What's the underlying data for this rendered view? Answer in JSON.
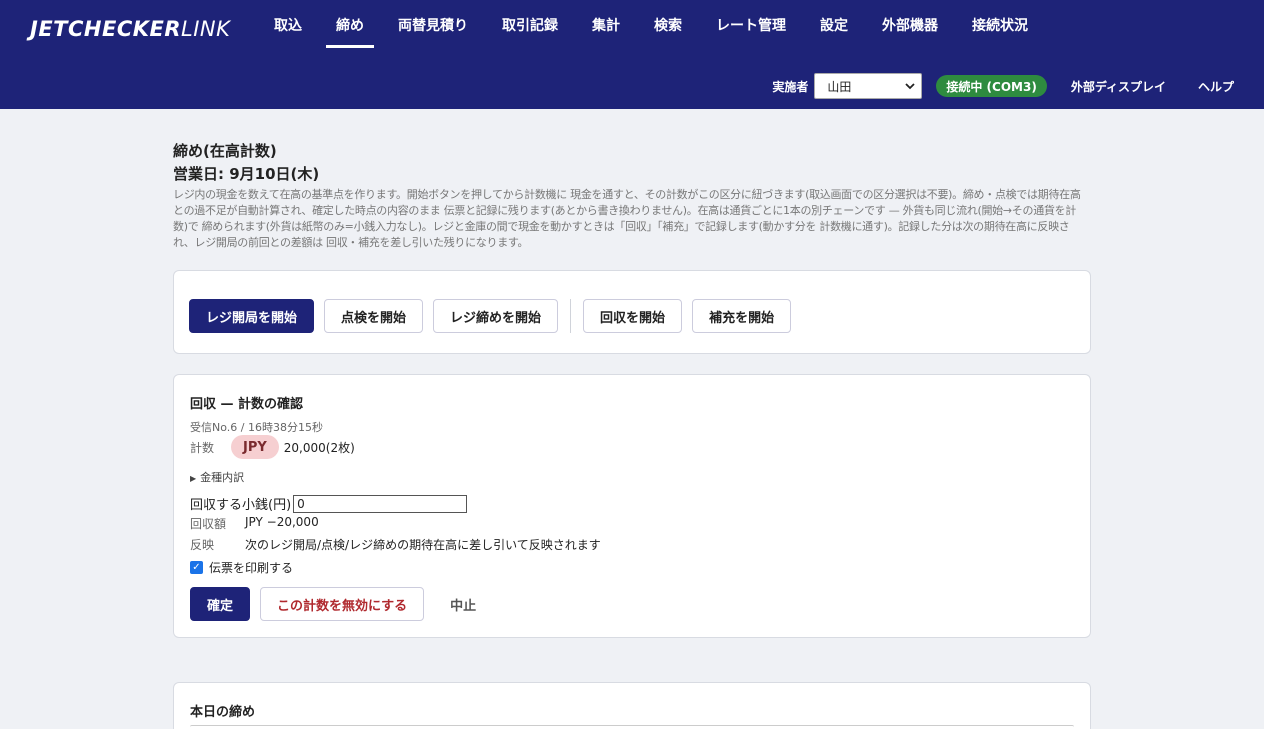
{
  "header": {
    "logo_bold": "JETCHECKER",
    "logo_light": "LINK",
    "nav": [
      "取込",
      "締め",
      "両替見積り",
      "取引記録",
      "集計",
      "検索",
      "レート管理",
      "設定",
      "外部機器",
      "接続状況"
    ],
    "active_nav": "締め",
    "operator_label": "実施者",
    "operator_value": "山田",
    "connection_status": "接続中 (COM3)",
    "external_display": "外部ディスプレイ",
    "help": "ヘルプ"
  },
  "page": {
    "title": "締め(在高計数)",
    "business_day": "営業日: 9月10日(木)",
    "description": "レジ内の現金を数えて在高の基準点を作ります。開始ボタンを押してから計数機に 現金を通すと、その計数がこの区分に紐づきます(取込画面での区分選択は不要)。締め・点検では期待在高との過不足が自動計算され、確定した時点の内容のまま 伝票と記録に残ります(あとから書き換わりません)。在高は通貨ごとに1本の別チェーンです — 外貨も同じ流れ(開始→その通貨を計数)で 締められます(外貨は紙幣のみ=小銭入力なし)。レジと金庫の間で現金を動かすときは「回収」「補充」で記録します(動かす分を 計数機に通す)。記録した分は次の期待在高に反映され、レジ開局の前回との差額は 回収・補充を差し引いた残りになります。"
  },
  "actions": {
    "open": "レジ開局を開始",
    "inspect": "点検を開始",
    "close": "レジ締めを開始",
    "collect": "回収を開始",
    "replenish": "補充を開始"
  },
  "confirm_panel": {
    "title": "回収 — 計数の確認",
    "received": "受信No.6 / 16時38分15秒",
    "count_label": "計数",
    "currency": "JPY",
    "count_amount": "20,000(2枚)",
    "denomination_toggle": "金種内訳",
    "coin_label": "回収する小銭(円)",
    "coin_value": "0",
    "amount_label": "回収額",
    "amount_value": "JPY −20,000",
    "reflect_label": "反映",
    "reflect_value": "次のレジ開局/点検/レジ締めの期待在高に差し引いて反映されます",
    "print_label": "伝票を印刷する",
    "print_checked": true,
    "confirm_button": "確定",
    "invalidate_button": "この計数を無効にする",
    "cancel_button": "中止"
  },
  "today_panel": {
    "title": "本日の締め"
  },
  "colors": {
    "header_bg": "#1e2378",
    "connected": "#2e8b3f",
    "currency_pill": "#f6cfd1",
    "danger": "#b0292e"
  }
}
